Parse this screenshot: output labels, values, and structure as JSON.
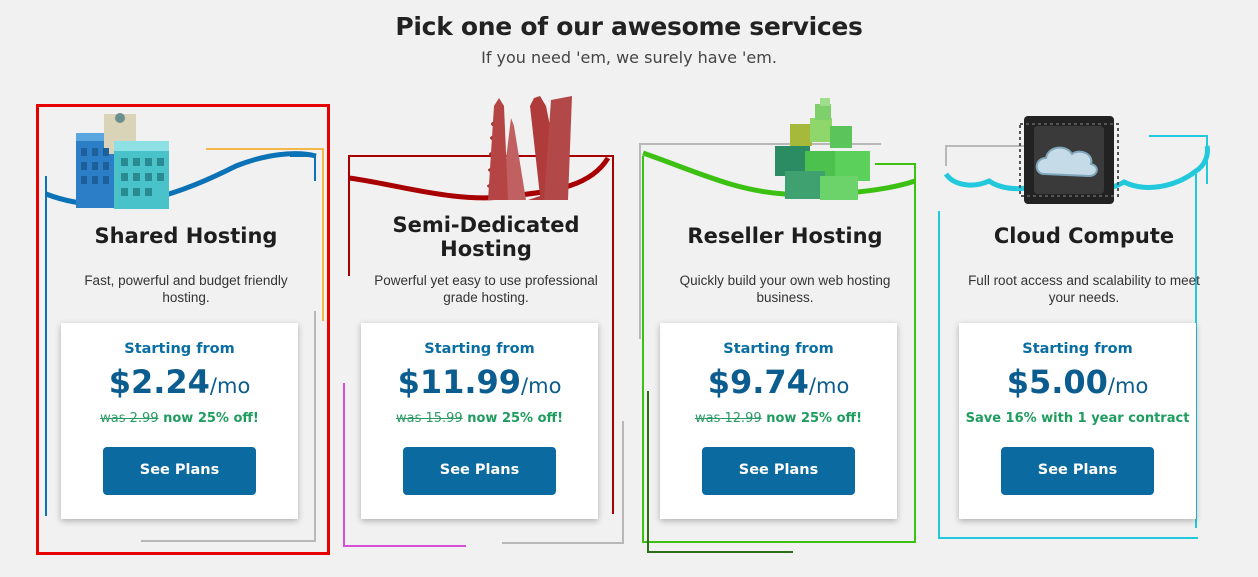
{
  "header": {
    "title": "Pick one of our awesome services",
    "subtitle": "If you need 'em, we surely have 'em."
  },
  "cards": [
    {
      "title": "Shared Hosting",
      "description": "Fast, powerful and budget friendly hosting.",
      "starting_label": "Starting from",
      "price": "$2.24",
      "period": "/mo",
      "was": "was 2.99",
      "deal": " now 25% off!",
      "button": "See Plans",
      "accent": "#0b72b5",
      "selected": true
    },
    {
      "title": "Semi-Dedicated Hosting",
      "title_line1": "Semi-Dedicated",
      "title_line2": "Hosting",
      "description": "Powerful yet easy to use professional grade hosting.",
      "starting_label": "Starting from",
      "price": "$11.99",
      "period": "/mo",
      "was": "was 15.99",
      "deal": " now 25% off!",
      "button": "See Plans",
      "accent": "#a80000"
    },
    {
      "title": "Reseller Hosting",
      "description": "Quickly build your own web hosting business.",
      "starting_label": "Starting from",
      "price": "$9.74",
      "period": "/mo",
      "was": "was 12.99",
      "deal": " now 25% off!",
      "button": "See Plans",
      "accent": "#3cc112"
    },
    {
      "title": "Cloud Compute",
      "description": "Full root access and scalability to meet your needs.",
      "starting_label": "Starting from",
      "price": "$5.00",
      "period": "/mo",
      "deal": "Save 16% with 1 year contract",
      "button": "See Plans",
      "accent": "#22c8dc"
    }
  ]
}
